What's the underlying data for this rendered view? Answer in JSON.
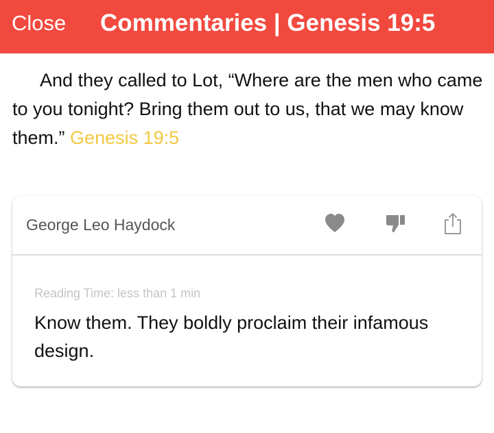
{
  "header": {
    "close_label": "Close",
    "title": "Commentaries | Genesis 19:5",
    "background_color": "#f2493f"
  },
  "verse": {
    "text": "And they called to Lot, “Where are the men who came to you tonight? Bring them out to us, that we may know them.”",
    "reference": "Genesis 19:5",
    "reference_color": "#f2c842"
  },
  "commentary": {
    "author": "George Leo Haydock",
    "actions": {
      "like_icon": "heart-icon",
      "dislike_icon": "thumbs-down-icon",
      "share_icon": "share-icon"
    },
    "reading_time": "Reading Time: less than 1 min",
    "text": "Know them. They boldly proclaim their infamous design."
  }
}
